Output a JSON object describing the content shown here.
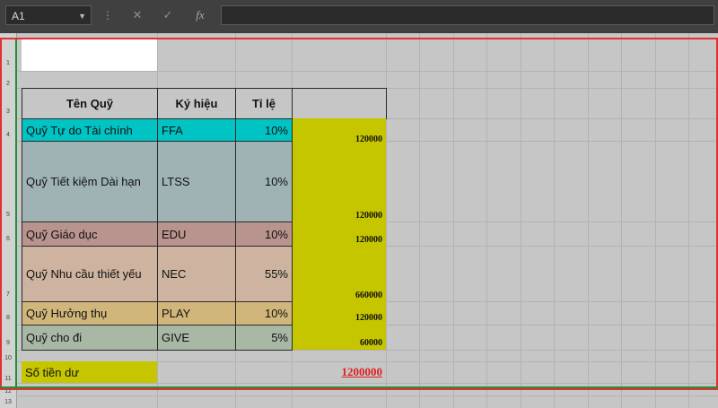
{
  "formula_bar": {
    "name_box": "A1",
    "fx_label": "fx",
    "formula": ""
  },
  "row_numbers": [
    "1",
    "2",
    "3",
    "4",
    "5",
    "6",
    "7",
    "8",
    "9",
    "10",
    "11",
    "12",
    "13"
  ],
  "table": {
    "headers": [
      "Tên Quỹ",
      "Ký hiệu",
      "Tỉ lệ"
    ],
    "rows": [
      {
        "name": "Quỹ Tự do Tài chính",
        "code": "FFA",
        "rate": "10%",
        "amount": "120000"
      },
      {
        "name": "Quỹ Tiết kiệm Dài hạn",
        "code": "LTSS",
        "rate": "10%",
        "amount": "120000"
      },
      {
        "name": "Quỹ Giáo dục",
        "code": "EDU",
        "rate": "10%",
        "amount": "120000"
      },
      {
        "name": "Quỹ Nhu cầu thiết yếu",
        "code": "NEC",
        "rate": "55%",
        "amount": "660000"
      },
      {
        "name": "Quỹ Hưởng thụ",
        "code": "PLAY",
        "rate": "10%",
        "amount": "120000"
      },
      {
        "name": "Quỹ cho đi",
        "code": "GIVE",
        "rate": "5%",
        "amount": "60000"
      }
    ],
    "total_label": "Số tiền dư",
    "total_value": "1200000"
  },
  "colors": {
    "cyan": "#00c4c4",
    "slate": "#9fb3b5",
    "rose": "#b9938d",
    "tan": "#cdb3a0",
    "gold": "#d1b67c",
    "sage": "#a8b8a4",
    "olive": "#c5c500",
    "red_total": "#e02020",
    "selection_red": "#e23030",
    "selection_green": "#1f8f3a"
  }
}
